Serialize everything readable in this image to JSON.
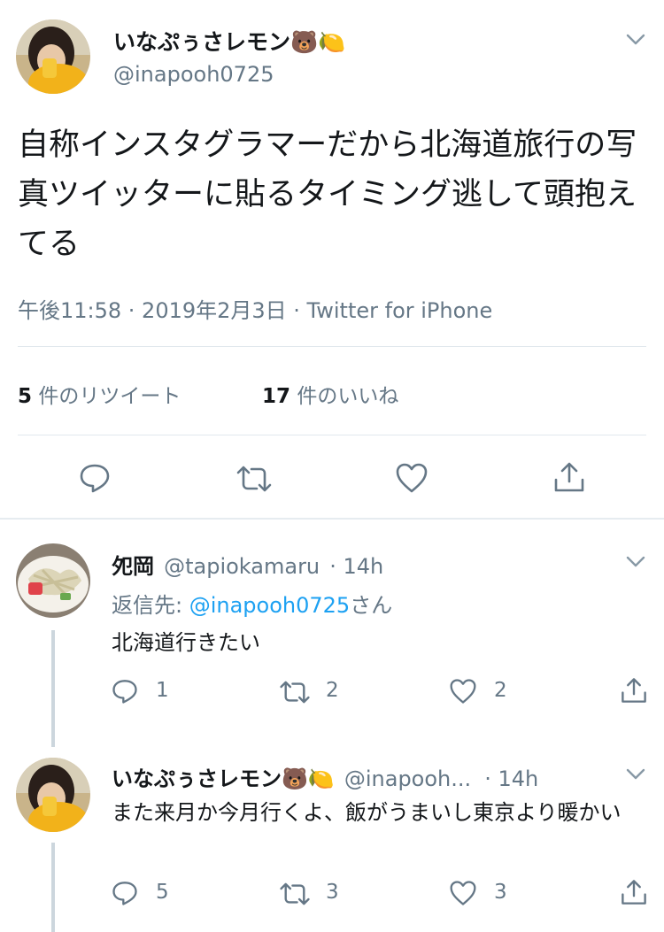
{
  "main_tweet": {
    "display_name": "いなぷぅさレモン",
    "name_emojis": "🐻🍋",
    "handle": "@inapooh0725",
    "text": "自称インスタグラマーだから北海道旅行の写真ツイッターに貼るタイミング逃して頭抱えてる",
    "timestamp": "午後11:58 · 2019年2月3日 · Twitter for iPhone",
    "retweet_count": "5",
    "retweet_label": " 件のリツイート",
    "like_count": "17",
    "like_label": " 件のいいね"
  },
  "replies": [
    {
      "display_name": "夗岡",
      "handle": "@tapiokamaru",
      "time": "· 14h",
      "reply_to_prefix": "返信先: ",
      "reply_to_handle": "@inapooh0725",
      "reply_to_suffix": "さん",
      "text": "北海道行きたい",
      "reply_count": "1",
      "retweet_count": "2",
      "like_count": "2"
    },
    {
      "display_name": "いなぷぅさレモン",
      "name_emojis": "🐻🍋",
      "handle": "@inapooh...",
      "time": "· 14h",
      "text": "また来月か今月行くよ、飯がうまいし東京より暖かい",
      "reply_count": "5",
      "retweet_count": "3",
      "like_count": "3"
    }
  ],
  "icons": {
    "reply": "reply-icon",
    "retweet": "retweet-icon",
    "like": "heart-icon",
    "share": "share-icon",
    "chevron": "chevron-down-icon"
  },
  "colors": {
    "text": "#14171a",
    "muted": "#657786",
    "link": "#1da1f2",
    "divider": "#e1e8ed"
  }
}
